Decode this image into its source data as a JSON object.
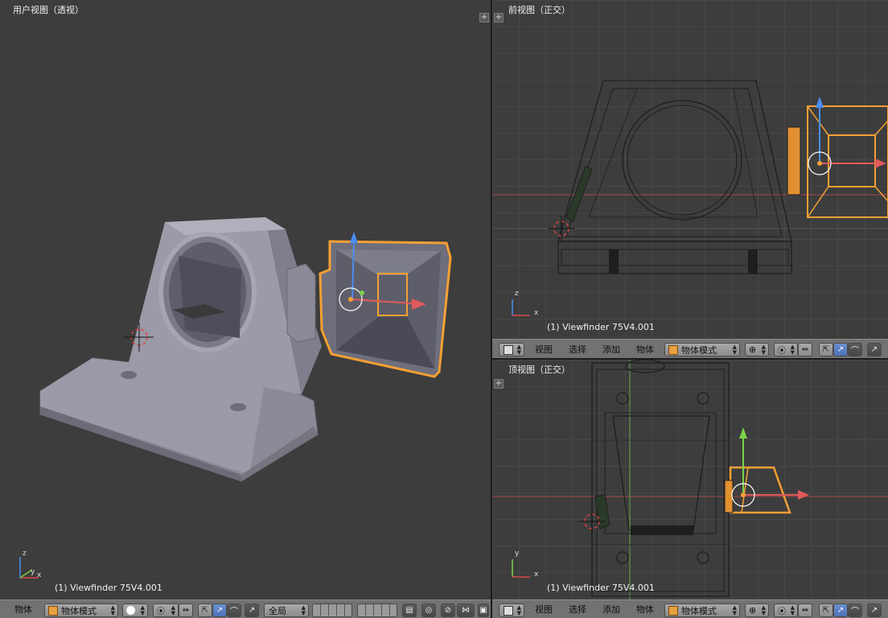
{
  "viewports": {
    "user": {
      "label": "用户视图（透视）",
      "info": "(1) Viewfinder 75V4.001"
    },
    "front": {
      "label": "前视图（正交）",
      "info": "(1) Viewfinder 75V4.001"
    },
    "top": {
      "label": "顶视图（正交）",
      "info": "(1) Viewfinder 75V4.001"
    }
  },
  "headers": {
    "bottom_left": {
      "object_menu": "物体",
      "mode": "物体模式",
      "pivot": "全局"
    },
    "front": {
      "view": "视图",
      "select": "选择",
      "add": "添加",
      "object": "物体",
      "mode": "物体模式"
    },
    "top": {
      "view": "视图",
      "select": "选择",
      "add": "添加",
      "object": "物体",
      "mode": "物体模式"
    }
  },
  "axes": {
    "x": "x",
    "y": "y",
    "z": "z"
  },
  "colors": {
    "selection": "#f5a033",
    "viewport_bg": "#3d3d3d",
    "header_bg": "#727272",
    "x_axis": "#d84a4a",
    "y_axis": "#7ad34a",
    "z_axis": "#4a8ef0"
  }
}
